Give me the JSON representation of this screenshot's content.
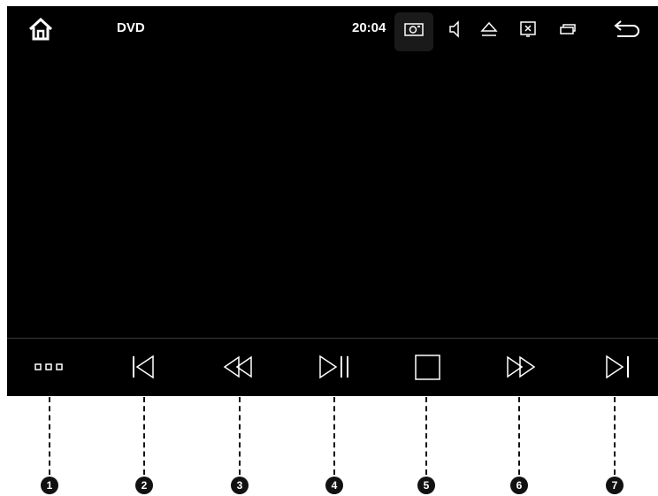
{
  "topbar": {
    "title": "DVD",
    "time": "20:04",
    "icons": [
      "home-icon",
      "camera-icon",
      "speaker-icon",
      "eject-icon",
      "screen-off-icon",
      "window-icon",
      "back-icon"
    ]
  },
  "controls": [
    {
      "name": "menu-button",
      "icon": "dots-icon"
    },
    {
      "name": "previous-track-button",
      "icon": "skip-previous-icon"
    },
    {
      "name": "rewind-button",
      "icon": "rewind-icon"
    },
    {
      "name": "play-pause-button",
      "icon": "play-pause-icon"
    },
    {
      "name": "stop-button",
      "icon": "stop-icon"
    },
    {
      "name": "fast-forward-button",
      "icon": "fast-forward-icon"
    },
    {
      "name": "next-track-button",
      "icon": "skip-next-icon"
    }
  ],
  "callouts": [
    "1",
    "2",
    "3",
    "4",
    "5",
    "6",
    "7"
  ],
  "colors": {
    "screen": "#000000",
    "icon": "#ffffff",
    "callout": "#111111"
  }
}
